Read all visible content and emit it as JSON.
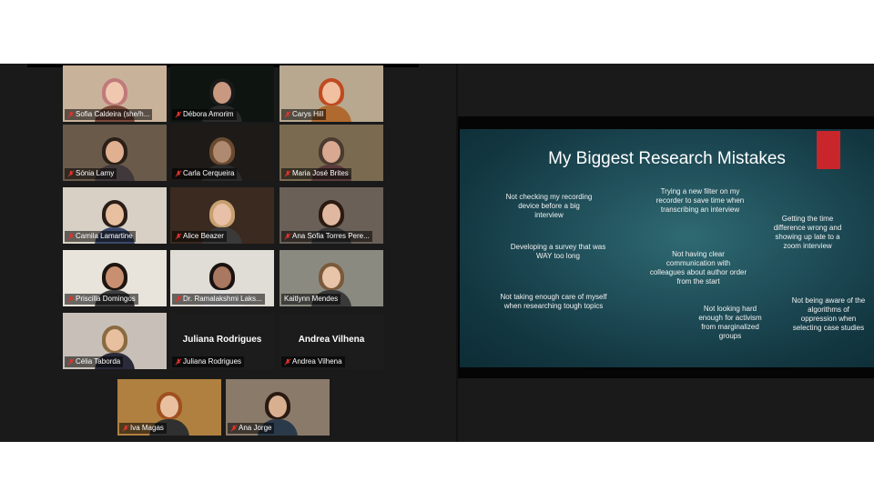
{
  "participants": [
    {
      "name": "Sofia Caldeira (she/h...",
      "muted": true
    },
    {
      "name": "Débora Amorim",
      "muted": true
    },
    {
      "name": "Carys Hill",
      "muted": true
    },
    {
      "name": "Sónia Lamy",
      "muted": true
    },
    {
      "name": "Carla Cerqueira",
      "muted": true
    },
    {
      "name": "Maria José Brites",
      "muted": true
    },
    {
      "name": "Camila Lamartine",
      "muted": true
    },
    {
      "name": "Alice Beazer",
      "muted": true
    },
    {
      "name": "Ana Sofia Torres Pere...",
      "muted": true
    },
    {
      "name": "Priscilla Domingos",
      "muted": true
    },
    {
      "name": "Dr. Ramalakshmi Laks...",
      "muted": true
    },
    {
      "name": "Kaitlynn Mendes",
      "muted": false
    },
    {
      "name": "Célia Taborda",
      "muted": true
    },
    {
      "name": "Juliana Rodrigues",
      "muted": true,
      "display_name": "Juliana Rodrigues"
    },
    {
      "name": "Andrea Vilhena",
      "muted": true,
      "display_name": "Andrea Vilhena"
    },
    {
      "name": "Iva Magas",
      "muted": true
    },
    {
      "name": "Ana Jorge",
      "muted": true
    }
  ],
  "slide": {
    "title": "My Biggest Research Mistakes",
    "notes": [
      "Not checking my recording device before a big interview",
      "Trying a new filter on my recorder to save time when transcribing an interview",
      "Getting the time difference wrong and showing up late to a zoom interview",
      "Developing a survey that was WAY too long",
      "Not having clear communication with colleagues about author order from the start",
      "Not taking enough care of myself when researching tough topics",
      "Not looking hard enough  for activism from marginalized groups",
      "Not being aware of the algorithms of oppression when selecting case studies"
    ]
  },
  "colors": {
    "active_speaker_border": "#c8d84a",
    "muted_icon": "#e0332c",
    "slide_accent": "#c8262a"
  }
}
